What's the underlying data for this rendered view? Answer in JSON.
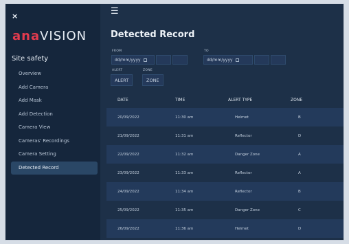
{
  "sidebar": {
    "close_label": "×",
    "logo_accent": "ana",
    "logo_rest": "VISION",
    "section_title": "Site safety",
    "items": [
      {
        "label": "Overview"
      },
      {
        "label": "Add Camera"
      },
      {
        "label": "Add Mask"
      },
      {
        "label": "Add Detection"
      },
      {
        "label": "Camera View"
      },
      {
        "label": "Cameras' Recordings"
      },
      {
        "label": "Camera Setting"
      },
      {
        "label": "Detected Record"
      }
    ],
    "active_item": "Detected Record"
  },
  "header": {
    "menu_icon": "☰"
  },
  "page": {
    "title": "Detected Record"
  },
  "filters": {
    "from_label": "FROM",
    "to_label": "TO",
    "from_value": "dd/mm/yyyy",
    "to_value": "dd/mm/yyyy",
    "alert_label": "ALERT",
    "zone_label": "ZONE",
    "alert_button": "ALERT",
    "zone_button": "ZONE"
  },
  "table": {
    "columns": [
      "DATE",
      "TIME",
      "ALERT TYPE",
      "ZONE"
    ],
    "rows": [
      [
        "20/09/2022",
        "11:30 am",
        "Helmet",
        "B"
      ],
      [
        "21/09/2022",
        "11:31 am",
        "Reflector",
        "D"
      ],
      [
        "22/09/2022",
        "11:32 am",
        "Danger Zone",
        "A"
      ],
      [
        "23/09/2022",
        "11:33 am",
        "Reflector",
        "A"
      ],
      [
        "24/09/2022",
        "11:34 am",
        "Reflector",
        "B"
      ],
      [
        "25/09/2022",
        "11:35 am",
        "Danger Zone",
        "C"
      ],
      [
        "26/09/2022",
        "11:36 am",
        "Helmet",
        "D"
      ]
    ]
  },
  "colors": {
    "sidebar_bg": "#15263c",
    "main_bg": "#1d3048",
    "row_alt_bg": "#233a5b",
    "logo_accent": "#e23b4e",
    "active_item_bg": "#2a4766"
  }
}
